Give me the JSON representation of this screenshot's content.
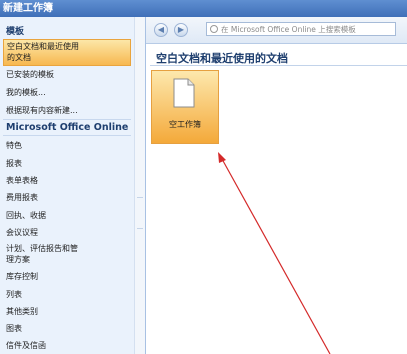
{
  "window": {
    "title": "新建工作簿"
  },
  "sidebar": {
    "header": "模板",
    "items": [
      {
        "label": "空白文档和最近使用\n的文档",
        "selected": true
      },
      {
        "label": "已安装的模板"
      },
      {
        "label": "我的模板..."
      },
      {
        "label": "根据现有内容新建..."
      }
    ],
    "online_header": "Microsoft Office Online",
    "online_items": [
      "特色",
      "报表",
      "表单表格",
      "费用报表",
      "回执、收据",
      "会议议程",
      "计划、评估报告和管\n理方案",
      "库存控制",
      "列表",
      "其他类别",
      "图表",
      "信件及信函"
    ]
  },
  "toolbar": {
    "back_icon": "back-arrow-icon",
    "forward_icon": "forward-arrow-icon",
    "search_placeholder": "在 Microsoft Office Online 上搜索模板"
  },
  "main": {
    "heading": "空白文档和最近使用的文档",
    "tiles": [
      {
        "label": "空工作簿",
        "icon": "blank-document-icon"
      }
    ]
  },
  "colors": {
    "selected_bg": "#f7b850",
    "sidebar_bg": "#eaf2fc",
    "heading_color": "#1f3f6f",
    "annotation_arrow": "#d42a2a"
  }
}
